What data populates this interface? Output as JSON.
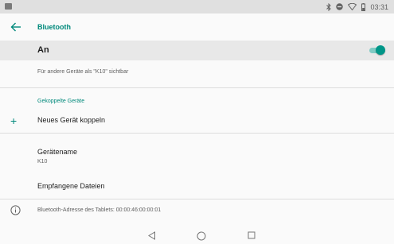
{
  "status_bar": {
    "time": "03:31",
    "icons": [
      "gallery-icon",
      "bluetooth-icon",
      "do-not-disturb-icon",
      "wifi-icon",
      "battery-icon"
    ]
  },
  "app_bar": {
    "back_icon": "arrow-back-icon",
    "title": "Bluetooth"
  },
  "master_switch": {
    "label": "An",
    "state": "on"
  },
  "visibility_text": "Für andere Geräte als \"K10\" sichtbar",
  "paired_section": {
    "header": "Gekoppelte Geräte",
    "pair_new_label": "Neues Gerät koppeln"
  },
  "device_name": {
    "title": "Gerätename",
    "value": "K10"
  },
  "received_files_label": "Empfangene Dateien",
  "footer_info": "Bluetooth-Adresse des Tablets: 00:00:46:00:00:01",
  "nav_bar": {
    "buttons": [
      "back-nav-icon",
      "home-nav-icon",
      "recents-nav-icon"
    ]
  },
  "colors": {
    "accent": "#009688",
    "accent_text": "#00897b",
    "status_bar": "#e0e0e0",
    "highlight_row": "#e8e8e8"
  }
}
